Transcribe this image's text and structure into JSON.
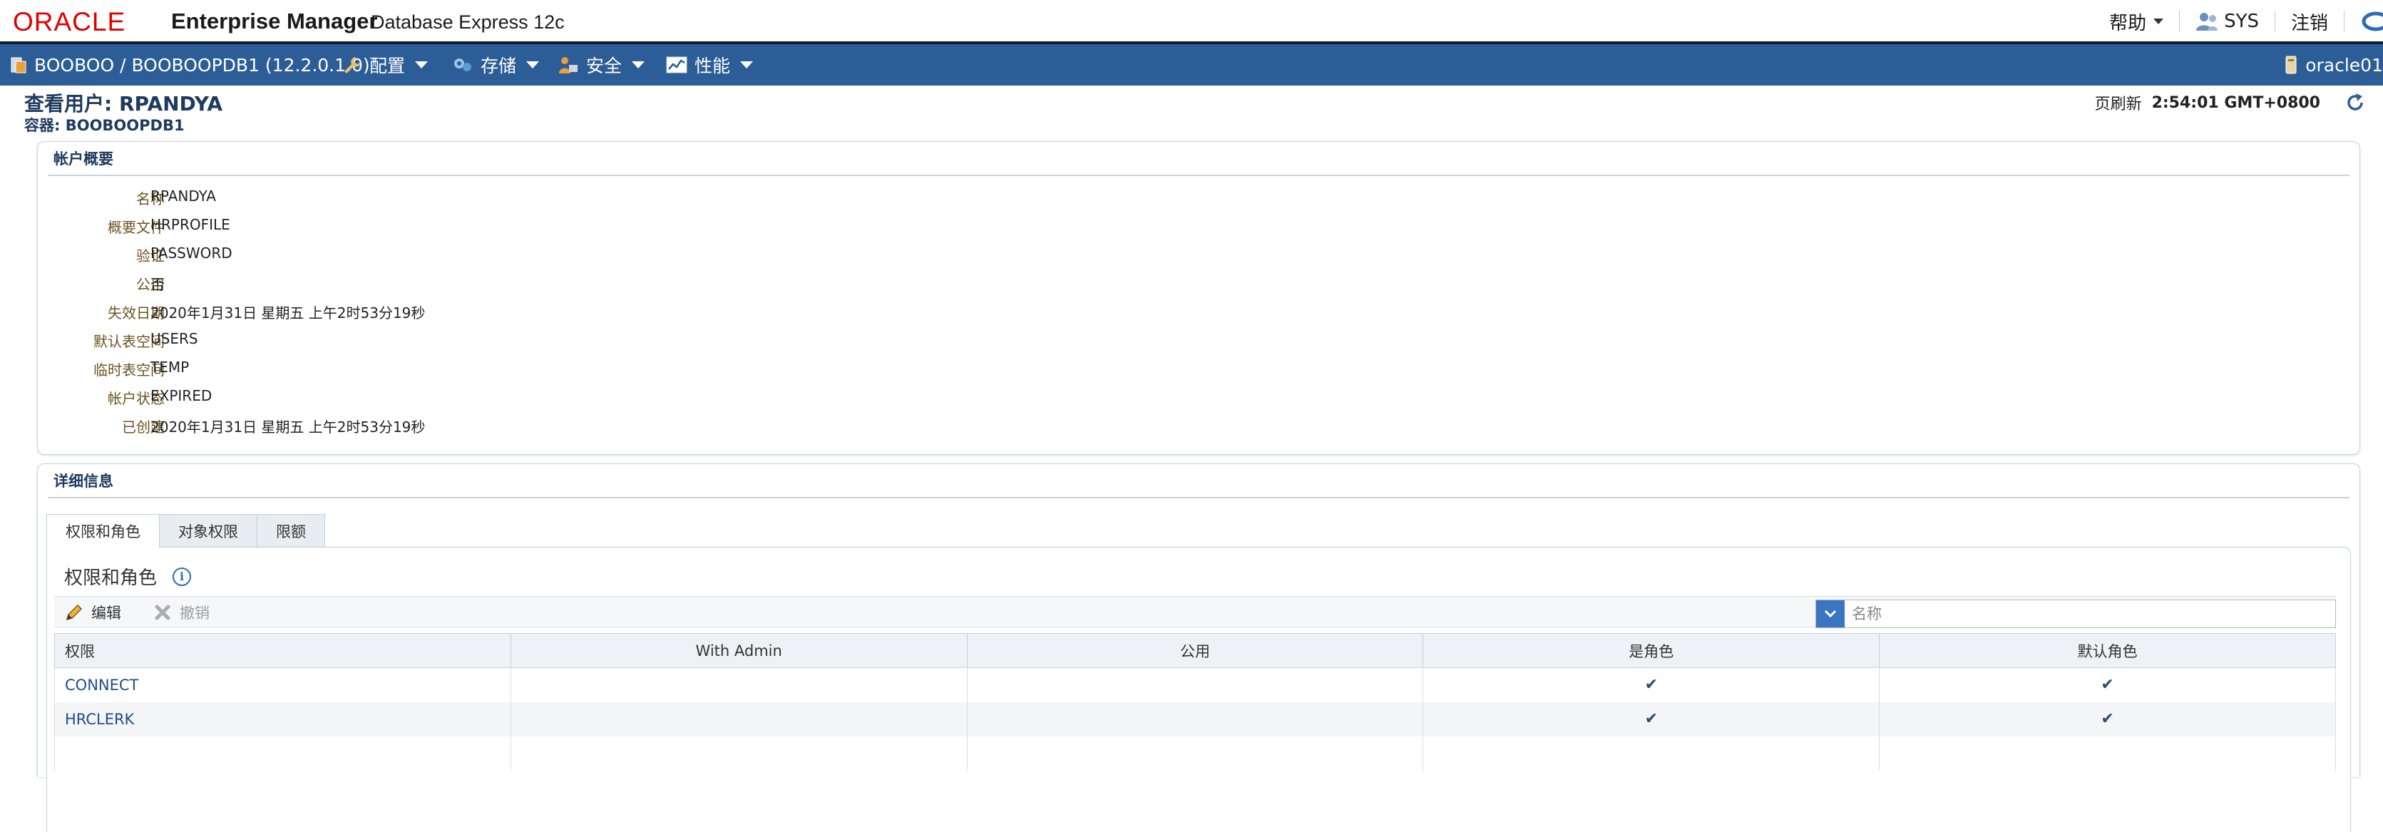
{
  "header": {
    "logo": "ORACLE",
    "product": "Enterprise Manager",
    "edition": "Database Express 12c",
    "help_label": "帮助",
    "user_label": "SYS",
    "logout_label": "注销"
  },
  "nav": {
    "database": "BOOBOO / BOOBOOPDB1 (12.2.0.1.0)",
    "menus": [
      "配置",
      "存储",
      "安全",
      "性能"
    ],
    "host": "oracle01"
  },
  "page": {
    "title": "查看用户: RPANDYA",
    "container": "容器: BOOBOOPDB1",
    "refresh_label": "页刷新",
    "refresh_time": "2:54:01 GMT+0800"
  },
  "account_summary": {
    "header": "帐户概要",
    "fields": [
      {
        "label": "名称",
        "value": "RPANDYA"
      },
      {
        "label": "概要文件",
        "value": "HRPROFILE"
      },
      {
        "label": "验证",
        "value": "PASSWORD"
      },
      {
        "label": "公用",
        "value": "否"
      },
      {
        "label": "失效日期",
        "value": "2020年1月31日 星期五 上午2时53分19秒"
      },
      {
        "label": "默认表空间",
        "value": "USERS"
      },
      {
        "label": "临时表空间",
        "value": "TEMP"
      },
      {
        "label": "帐户状态",
        "value": "EXPIRED"
      },
      {
        "label": "已创建",
        "value": "2020年1月31日 星期五 上午2时53分19秒"
      }
    ]
  },
  "details": {
    "header": "详细信息",
    "tabs": [
      "权限和角色",
      "对象权限",
      "限额"
    ],
    "active_tab": 0,
    "section_title": "权限和角色",
    "toolbar": {
      "edit_label": "编辑",
      "revoke_label": "撤销",
      "search_placeholder": "名称"
    },
    "table": {
      "columns": [
        "权限",
        "With Admin",
        "公用",
        "是角色",
        "默认角色"
      ],
      "rows": [
        {
          "privilege": "CONNECT",
          "with_admin": "",
          "common": "",
          "is_role": true,
          "default_role": true
        },
        {
          "privilege": "HRCLERK",
          "with_admin": "",
          "common": "",
          "is_role": true,
          "default_role": true
        }
      ]
    }
  },
  "colors": {
    "oracle_red": "#e00000",
    "nav_blue": "#2d5d96",
    "label_brown": "#6b5320",
    "link_blue": "#1f4d8c"
  }
}
